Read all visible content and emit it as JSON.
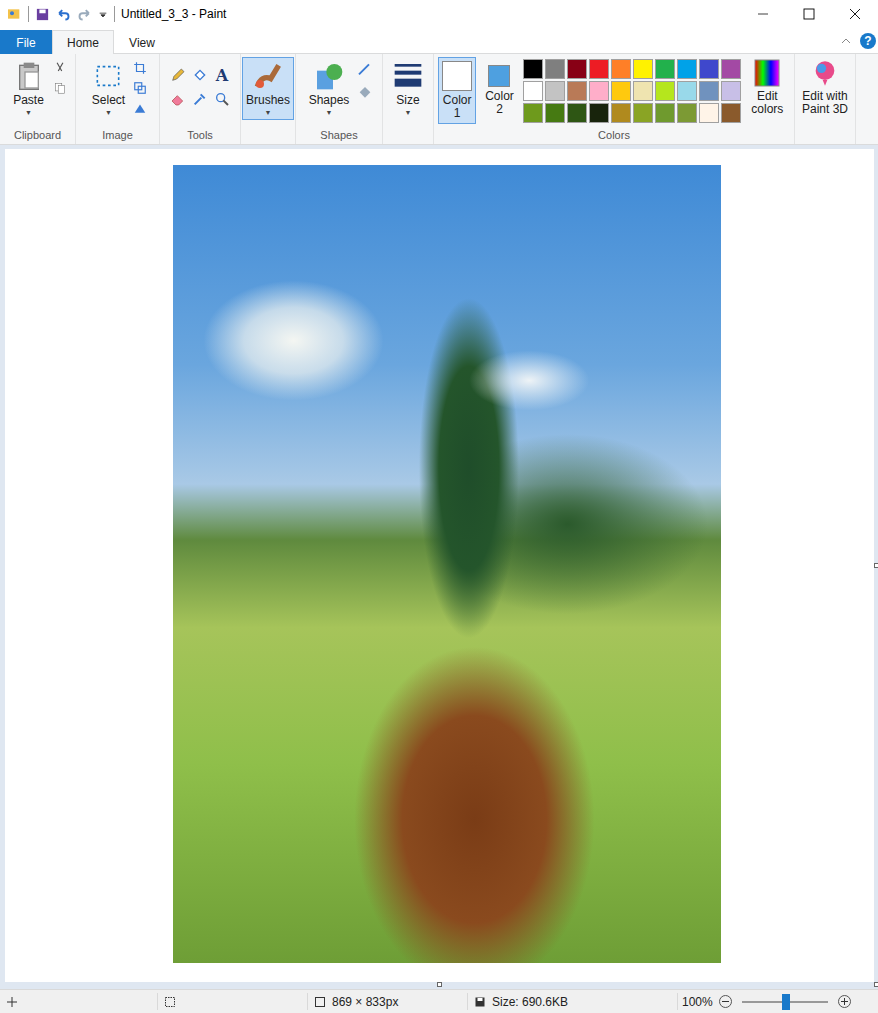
{
  "window": {
    "title": "Untitled_3_3 - Paint"
  },
  "tabs": [
    {
      "label": "File",
      "selected": false,
      "kind": "file"
    },
    {
      "label": "Home",
      "selected": true,
      "kind": "tab"
    },
    {
      "label": "View",
      "selected": false,
      "kind": "tab"
    }
  ],
  "help": "?",
  "ribbon": {
    "clipboard": {
      "label": "Clipboard",
      "paste": "Paste"
    },
    "image": {
      "label": "Image",
      "select": "Select"
    },
    "tools": {
      "label": "Tools",
      "text_tool": "A"
    },
    "brushes": {
      "label": "Brushes",
      "selected": true
    },
    "shapes": {
      "label": "Shapes",
      "button": "Shapes"
    },
    "size": {
      "label": "Size"
    },
    "colors": {
      "label": "Colors",
      "slots": [
        {
          "label": "Color 1",
          "color": "#ffffff",
          "selected": true
        },
        {
          "label": "Color 2",
          "color": "#4ea0e0",
          "selected": false
        }
      ],
      "palette": [
        "#000000",
        "#7f7f7f",
        "#880015",
        "#ed1c24",
        "#ff7f27",
        "#fff200",
        "#22b14c",
        "#00a2e8",
        "#3f48cc",
        "#a349a4",
        "#ffffff",
        "#c3c3c3",
        "#b97a57",
        "#ffaec9",
        "#ffc90e",
        "#efe4b0",
        "#b5e61d",
        "#99d9ea",
        "#7092be",
        "#c8bfe7",
        "#6e9a1c",
        "#467a12",
        "#2e5614",
        "#18240c",
        "#b08a1e",
        "#8aa424",
        "#6f9a2e",
        "#7c9a34",
        "#fff4e8",
        "#8a5a2c"
      ],
      "edit": "Edit colors"
    },
    "paint3d": {
      "label": "Edit with Paint 3D"
    }
  },
  "status_bar": {
    "dimensions": "869 × 833px",
    "size": "Size: 690.6KB",
    "zoom": "100%",
    "zoom_level": 0.52
  }
}
